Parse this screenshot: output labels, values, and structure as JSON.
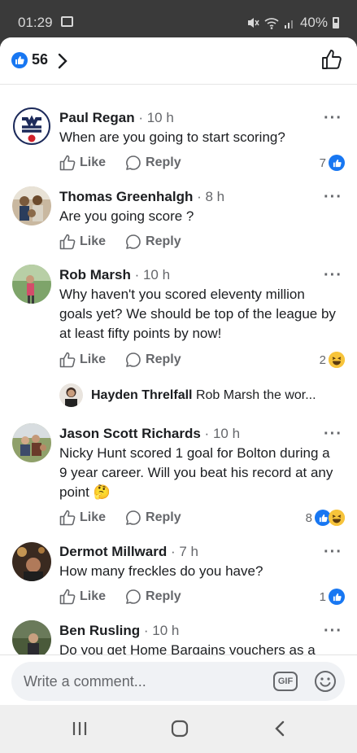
{
  "status_bar": {
    "time": "01:29",
    "battery": "40%"
  },
  "header": {
    "like_count": "56"
  },
  "actions": {
    "like": "Like",
    "reply": "Reply"
  },
  "comments": [
    {
      "name": "Paul Regan",
      "time": "10 h",
      "text": "When are you going to start scoring?",
      "reactions": "7",
      "reaction_types": [
        "like"
      ]
    },
    {
      "name": "Thomas Greenhalgh",
      "time": "8 h",
      "text": "Are you going score ?",
      "reactions": "",
      "reaction_types": []
    },
    {
      "name": "Rob Marsh",
      "time": "10 h",
      "text": "Why haven't you scored eleventy million goals yet? We should be top of the league by at least fifty points by now!",
      "reactions": "2",
      "reaction_types": [
        "haha"
      ]
    },
    {
      "name": "Jason Scott Richards",
      "time": "10 h",
      "text": "Nicky Hunt scored 1 goal for Bolton during a 9 year career. Will you beat his record at any point 🤔",
      "reactions": "8",
      "reaction_types": [
        "like",
        "haha"
      ]
    },
    {
      "name": "Dermot Millward",
      "time": "7 h",
      "text": "How many freckles do you have?",
      "reactions": "1",
      "reaction_types": [
        "like"
      ]
    },
    {
      "name": "Ben Rusling",
      "time": "10 h",
      "text": "Do you get Home Bargains vouchers as a",
      "reactions": "",
      "reaction_types": []
    }
  ],
  "reply_preview": {
    "name": "Hayden Threlfall",
    "text": "Rob Marsh the wor..."
  },
  "composer": {
    "placeholder": "Write a comment...",
    "gif_label": "GIF"
  },
  "colors": {
    "facebook_blue": "#1877f2",
    "secondary_text": "#65676b",
    "haha_yellow": "#f7c43b"
  }
}
